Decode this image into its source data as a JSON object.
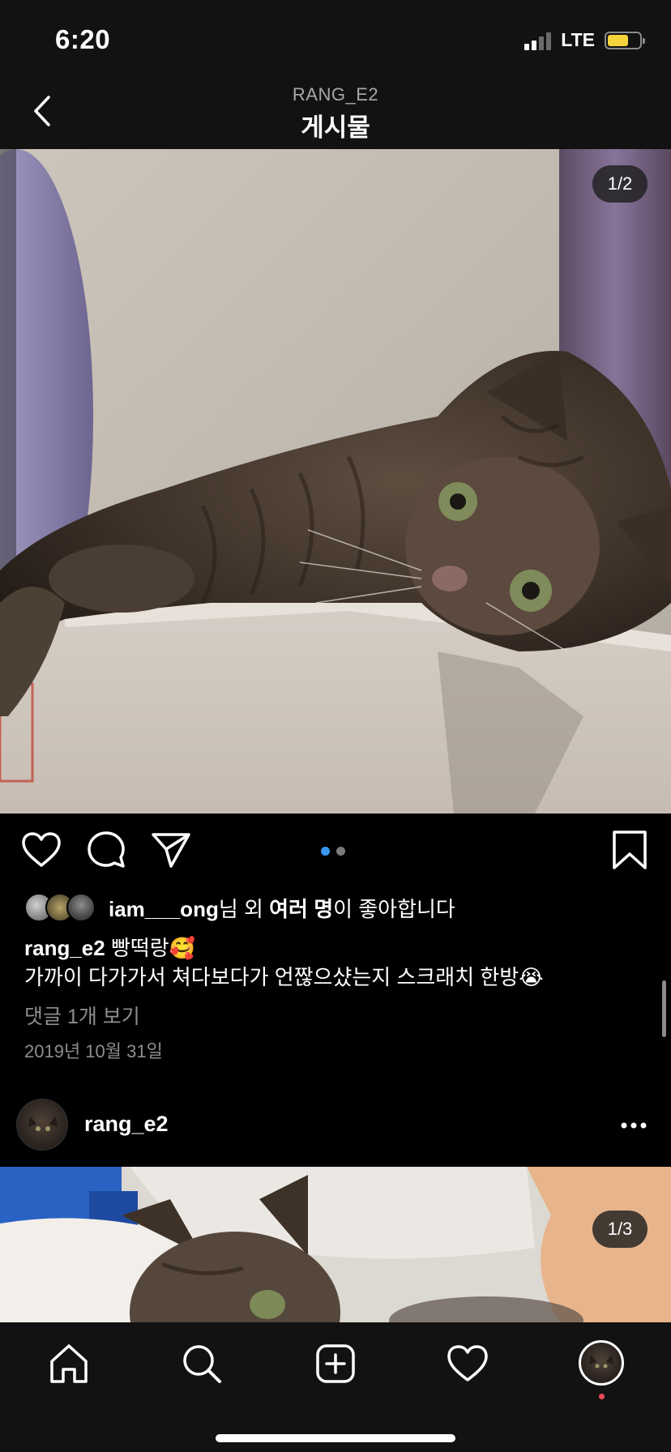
{
  "status_bar": {
    "time": "6:20",
    "network": "LTE"
  },
  "header": {
    "subtitle": "RANG_E2",
    "title": "게시물"
  },
  "post1": {
    "counter": "1/2",
    "likes": {
      "username": "iam___ong",
      "suffix_1": "님 외 ",
      "others": "여러 명",
      "suffix_2": "이 좋아합니다"
    },
    "caption": {
      "username": "rang_e2",
      "line1": "빵떡랑🥰",
      "line2": "가까이 다가가서 쳐다보다가 언짢으샸는지 스크래치 한방😭"
    },
    "view_comments": "댓글 1개 보기",
    "date": "2019년 10월 31일",
    "carousel": {
      "count": 2,
      "active": 1
    }
  },
  "post2": {
    "username": "rang_e2",
    "counter": "1/3"
  },
  "tab_bar": {
    "items": [
      "home-icon",
      "search-icon",
      "add-post-icon",
      "activity-heart-icon",
      "profile-avatar"
    ]
  }
}
